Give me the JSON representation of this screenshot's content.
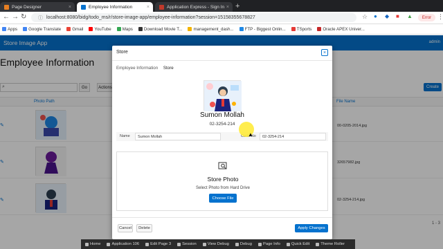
{
  "browser": {
    "tabs": [
      {
        "label": "Page Designer",
        "active": false
      },
      {
        "label": "Employee Information",
        "active": true
      },
      {
        "label": "Application Express - Sign In",
        "active": false
      }
    ],
    "url": "localhost:8080/bidg/todo_ms/r/store-image-app/employee-information?session=15158355678827",
    "error_label": "Error",
    "bookmarks": [
      "Apps",
      "Google Translate",
      "Gmail",
      "YouTube",
      "Maps",
      "Download Movie T...",
      "management_dash...",
      "FTP - Biggest Onlin...",
      "TSports",
      "Oracle APEX Univer..."
    ]
  },
  "app": {
    "title": "Store Image App",
    "user": "admin",
    "page_title": "Employee Information",
    "go_label": "Go",
    "actions_label": "Actions",
    "create_label": "Create",
    "columns": {
      "photo": "Photo Path",
      "file": "File Name"
    },
    "rows": [
      {
        "file": "00-0205-2014.jpg"
      },
      {
        "file": "32657982.jpg"
      },
      {
        "file": "02-3254-214.jpg"
      }
    ],
    "pagination": "1 - 3"
  },
  "modal": {
    "title": "Store",
    "breadcrumb": [
      "Employee Information",
      "Store"
    ],
    "employee_name": "Sumon Mollah",
    "employee_code": "02-3254-214",
    "name_label": "Name",
    "name_value": "Sumon Mollah",
    "code_label": "Code No",
    "code_value": "02-3254-214",
    "dropzone_title": "Store Photo",
    "dropzone_subtitle": "Select Photo from Hard Drive",
    "choose_file_label": "Choose File",
    "cancel_label": "Cancel",
    "delete_label": "Delete",
    "apply_label": "Apply Changes"
  },
  "devbar": [
    "Home",
    "Application 106",
    "Edit Page 3",
    "Session",
    "View Debug",
    "Debug",
    "Page Info",
    "Quick Edit",
    "Theme Roller"
  ],
  "colors": {
    "accent": "#0572ce",
    "cursor_highlight": "#ffeb3b"
  }
}
